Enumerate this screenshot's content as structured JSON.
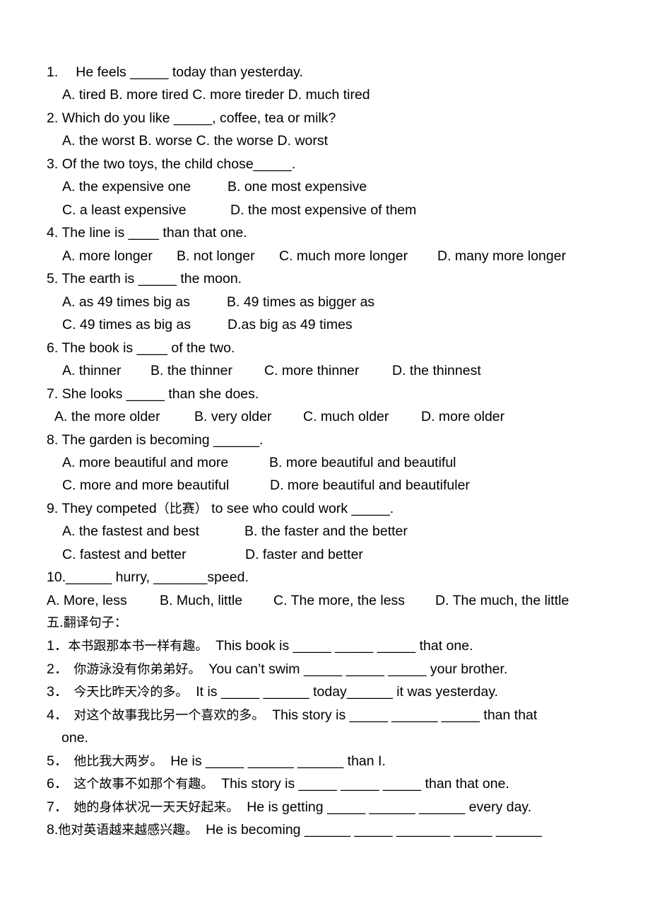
{
  "section_choice": {
    "questions": [
      {
        "number": "1.",
        "stem": "He feels _____ today than yesterday.",
        "options_lines": [
          "A. tired B. more tired C. more tireder D. much tired"
        ]
      },
      {
        "number": "2.",
        "stem": "Which do you like _____, coffee, tea or milk?",
        "options_lines": [
          "A. the worst B. worse C. the worse D. worst"
        ]
      },
      {
        "number": "3.",
        "stem": "Of the two toys, the child chose_____.",
        "options_lines": [
          "A. the expensive one",
          "B. one most expensive",
          "C. a least expensive",
          "D. the most expensive of them"
        ]
      },
      {
        "number": "4.",
        "stem": "The line is ____ than that one.",
        "options_lines": [
          "A. more longer",
          "B. not longer",
          "C. much more longer",
          "D. many more longer"
        ]
      },
      {
        "number": "5.",
        "stem": "The earth is _____ the moon.",
        "options_lines": [
          "A. as 49 times big as",
          "B. 49 times as bigger as",
          "C. 49 times as big as",
          "D.as big as 49 times"
        ]
      },
      {
        "number": "6.",
        "stem": "The book is ____ of the two.",
        "options_lines": [
          "A. thinner",
          "B. the thinner",
          "C. more thinner",
          "D. the thinnest"
        ]
      },
      {
        "number": "7.",
        "stem": "She looks _____ than she does.",
        "options_lines": [
          "A. the more older",
          "B. very older",
          "C. much older",
          "D. more older"
        ]
      },
      {
        "number": "8.",
        "stem": "The garden is becoming ______.",
        "options_lines": [
          "A. more beautiful and more",
          "B. more beautiful and beautiful",
          "C. more and more beautiful",
          "D. more beautiful and beautifuler"
        ]
      },
      {
        "number": "9.",
        "stem_pre": "They competed",
        "stem_cn": "（比赛）",
        "stem_post": " to see who could work _____.",
        "options_lines": [
          "A. the fastest and best",
          "B. the faster and the better",
          "C. fastest and better",
          "D. faster and better"
        ]
      },
      {
        "number": "10.",
        "stem": "______ hurry, _______speed.",
        "options_lines": [
          "A. More, less",
          "B. Much, little",
          "C. The more, the less",
          "D. The much, the little"
        ]
      }
    ]
  },
  "section_translate": {
    "heading": "五.翻译句子：",
    "items": [
      {
        "number": "1．",
        "cn": "本书跟那本书一样有趣。",
        "en": "This book is _____ _____ _____ that one."
      },
      {
        "number": "2．",
        "cn": "你游泳没有你弟弟好。",
        "en": "You can’t swim _____ _____ _____ your brother."
      },
      {
        "number": "3．",
        "cn": "今天比昨天冷的多。",
        "en": "It is _____ ______ today______ it was yesterday."
      },
      {
        "number": "4．",
        "cn": "对这个故事我比另一个喜欢的多。",
        "en": "This story is _____ ______ _____ than that",
        "en_cont": "one."
      },
      {
        "number": "5．",
        "cn": "他比我大两岁。",
        "en": "He is _____ ______ ______ than I."
      },
      {
        "number": "6．",
        "cn": "这个故事不如那个有趣。",
        "en": "This story is _____ _____ _____ than that one."
      },
      {
        "number": "7．",
        "cn": "她的身体状况一天天好起来。",
        "en": "He is getting _____ ______ ______ every day."
      },
      {
        "number": "8.",
        "cn": "他对英语越来越感兴趣。",
        "en": "He is becoming ______ _____ _______ _____ ______"
      }
    ]
  }
}
